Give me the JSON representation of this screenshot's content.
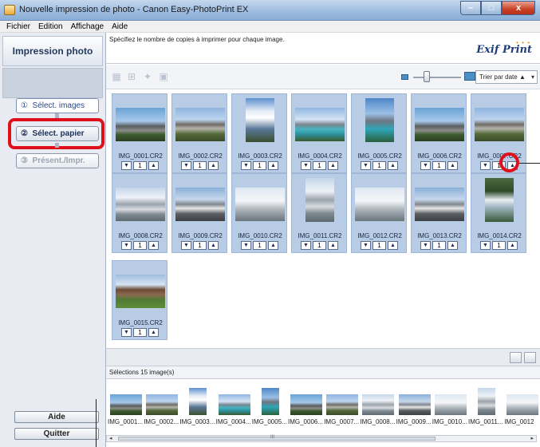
{
  "window": {
    "title": "Nouvelle impression de photo - Canon Easy-PhotoPrint EX",
    "minimize": "–",
    "maximize": "□",
    "close": "x"
  },
  "menu": [
    "Fichier",
    "Edition",
    "Affichage",
    "Aide"
  ],
  "sidebar": {
    "header": "Impression photo",
    "steps": [
      {
        "number": "①",
        "label": "Sélect. images",
        "state": "done"
      },
      {
        "number": "②",
        "label": "Sélect. papier",
        "state": "current"
      },
      {
        "number": "③",
        "label": "Présent./Impr.",
        "state": "disabled"
      }
    ],
    "help_label": "Aide",
    "quit_label": "Quitter"
  },
  "instruction": "Spécifiez le nombre de copies à imprimer pour chaque image.",
  "exif_logo": "Exif Print",
  "toolbar": {
    "sort_label": "Trier par date",
    "sort_arrow": "▲"
  },
  "photos": [
    {
      "name": "IMG_0001.CR2",
      "copies": "1",
      "style": "ph-mtn"
    },
    {
      "name": "IMG_0002.CR2",
      "copies": "1",
      "style": "ph-mtn2"
    },
    {
      "name": "IMG_0003.CR2",
      "copies": "1",
      "style": "ph-sky",
      "portrait": true
    },
    {
      "name": "IMG_0004.CR2",
      "copies": "1",
      "style": "ph-lake"
    },
    {
      "name": "IMG_0005.CR2",
      "copies": "1",
      "style": "ph-lake2",
      "portrait": true
    },
    {
      "name": "IMG_0006.CR2",
      "copies": "1",
      "style": "ph-mtn"
    },
    {
      "name": "IMG_0007.CR2",
      "copies": "1",
      "style": "ph-mtn2"
    },
    {
      "name": "IMG_0008.CR2",
      "copies": "1",
      "style": "ph-glac"
    },
    {
      "name": "IMG_0009.CR2",
      "copies": "1",
      "style": "ph-bus"
    },
    {
      "name": "IMG_0010.CR2",
      "copies": "1",
      "style": "ph-glac2"
    },
    {
      "name": "IMG_0011.CR2",
      "copies": "1",
      "style": "ph-glac",
      "portrait": true
    },
    {
      "name": "IMG_0012.CR2",
      "copies": "1",
      "style": "ph-glac2"
    },
    {
      "name": "IMG_0013.CR2",
      "copies": "1",
      "style": "ph-bus"
    },
    {
      "name": "IMG_0014.CR2",
      "copies": "1",
      "style": "ph-fall",
      "portrait": true
    },
    {
      "name": "IMG_0015.CR2",
      "copies": "1",
      "style": "ph-lodge"
    }
  ],
  "stepper": {
    "down": "▼",
    "up": "▲"
  },
  "selection_label": "Sélections 15 image(s)",
  "strip": [
    {
      "name": "IMG_0001...",
      "style": "ph-mtn"
    },
    {
      "name": "IMG_0002...",
      "style": "ph-mtn2"
    },
    {
      "name": "IMG_0003...",
      "style": "ph-sky",
      "portrait": true
    },
    {
      "name": "IMG_0004...",
      "style": "ph-lake"
    },
    {
      "name": "IMG_0005...",
      "style": "ph-lake2",
      "portrait": true
    },
    {
      "name": "IMG_0006...",
      "style": "ph-mtn"
    },
    {
      "name": "IMG_0007...",
      "style": "ph-mtn2"
    },
    {
      "name": "IMG_0008...",
      "style": "ph-glac"
    },
    {
      "name": "IMG_0009...",
      "style": "ph-bus"
    },
    {
      "name": "IMG_0010...",
      "style": "ph-glac2"
    },
    {
      "name": "IMG_0011...",
      "style": "ph-glac",
      "portrait": true
    },
    {
      "name": "IMG_0012",
      "style": "ph-glac2"
    }
  ],
  "scroll_marker": "III"
}
